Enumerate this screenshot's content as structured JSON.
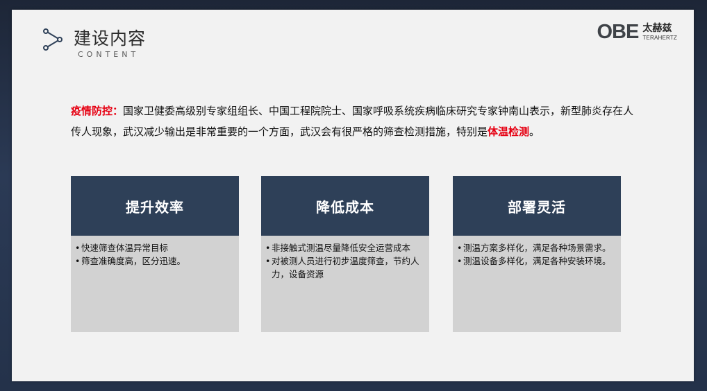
{
  "header": {
    "title_zh": "建设内容",
    "title_en": "CONTENT"
  },
  "logo": {
    "mark": "OBE",
    "cn": "太赫兹",
    "en": "TERAHERTZ"
  },
  "intro": {
    "label": "疫情防控",
    "sep": "：",
    "text1": "国家卫健委高级别专家组组长、中国工程院院士、国家呼吸系统疾病临床研究专家钟南山表示，新型肺炎存在人传人现象，武汉减少输出是非常重要的一个方面，武汉会有很严格的筛查检测措施，特别是",
    "highlight": "体温检测",
    "end": "。"
  },
  "cards": [
    {
      "title": "提升效率",
      "items": [
        "快速筛查体温异常目标",
        "筛查准确度高，区分迅速。"
      ]
    },
    {
      "title": "降低成本",
      "items": [
        "非接触式测温尽量降低安全运营成本",
        "对被测人员进行初步温度筛查，节约人力，设备资源"
      ]
    },
    {
      "title": "部署灵活",
      "items": [
        "测温方案多样化，满足各种场景需求。",
        "测温设备多样化，满足各种安装环境。"
      ]
    }
  ],
  "colors": {
    "accent_red": "#e60012",
    "card_header": "#2e4058",
    "card_body": "#d2d2d2"
  }
}
